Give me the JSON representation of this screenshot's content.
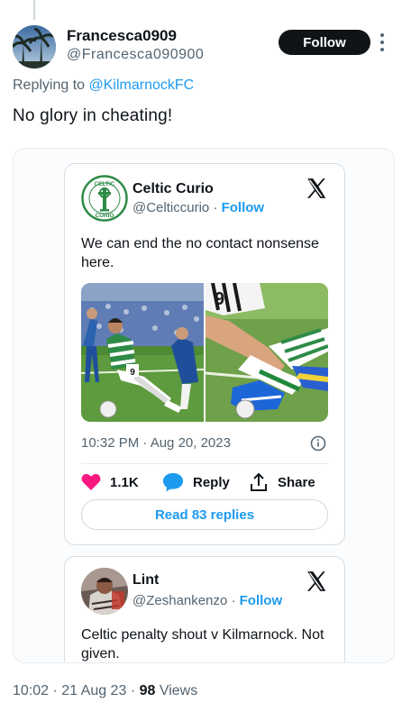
{
  "tweet": {
    "display_name": "Francesca0909",
    "handle": "@Francesca090900",
    "follow_label": "Follow",
    "replying_prefix": "Replying to",
    "replying_to": "@KilmarnockFC",
    "text": "No glory in cheating!",
    "time": "10:02",
    "date": "21 Aug 23",
    "views_count": "98",
    "views_label": "Views",
    "separator": "·"
  },
  "embed": {
    "name": "Celtic Curio",
    "handle": "@Celticcurio",
    "follow_label": "Follow",
    "separator": "·",
    "text": "We can end the no contact nonsense here.",
    "timestamp": "10:32 PM · Aug 20, 2023",
    "likes": "1.1K",
    "reply_label": "Reply",
    "share_label": "Share",
    "read_replies": "Read 83 replies",
    "logo_text_top": "CELTIC",
    "logo_text_bottom": "CURIO",
    "shirt_number": "9"
  },
  "embed2": {
    "name": "Lint",
    "handle": "@Zeshankenzo",
    "follow_label": "Follow",
    "separator": "·",
    "text": "Celtic penalty shout v Kilmarnock. Not given."
  },
  "colors": {
    "accent": "#1d9bf0",
    "heart": "#f91880",
    "text": "#0f1419",
    "muted": "#536471",
    "celtic_green": "#2e8b47"
  }
}
